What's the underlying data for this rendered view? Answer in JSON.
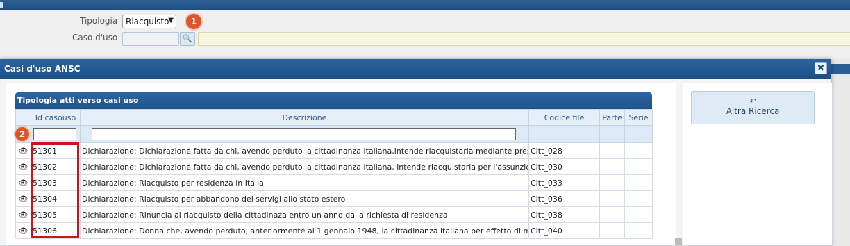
{
  "search": {
    "tipologia_label": "Tipologia",
    "tipologia_value": "Riacquisto",
    "caso_uso_label": "Caso d'uso",
    "badge1": "1"
  },
  "dialog": {
    "title": "Casi d'uso ANSC",
    "close": "✖",
    "grid_title": "Tipologia atti verso casi uso",
    "badge2": "2",
    "columns": [
      "",
      "Id casouso",
      "Descrizione",
      "Codice file",
      "Parte",
      "Serie"
    ],
    "rows": [
      {
        "id": "51301",
        "desc": "Dichiarazione: Dichiarazione fatta da chi, avendo perduto la cittadinanza italiana,intende riacquistarla mediante prestazione d",
        "code": "Citt_028"
      },
      {
        "id": "51302",
        "desc": "Dichiarazione: Dichiarazione fatta da chi, avendo perduto la cittadinanza italiana, intende riacquistarla per l'assunzione di pub",
        "code": "Citt_030"
      },
      {
        "id": "51303",
        "desc": "Dichiarazione: Riacquisto per residenza in Italia",
        "code": "Citt_033"
      },
      {
        "id": "51304",
        "desc": "Dichiarazione: Riacquisto per abbandono dei servigi allo stato estero",
        "code": "Citt_036"
      },
      {
        "id": "51305",
        "desc": "Dichiarazione: Rinuncia al riacquisto della cittadinaza entro un anno dalla richiesta di residenza",
        "code": "Citt_038"
      },
      {
        "id": "51306",
        "desc": "Dichiarazione: Donna che, avendo perduto, anteriormente al 1 gennaio 1948, la cittadinanza italiana per effetto di matrimonio",
        "code": "Citt_040"
      }
    ],
    "alt_button": "Altra Ricerca"
  }
}
